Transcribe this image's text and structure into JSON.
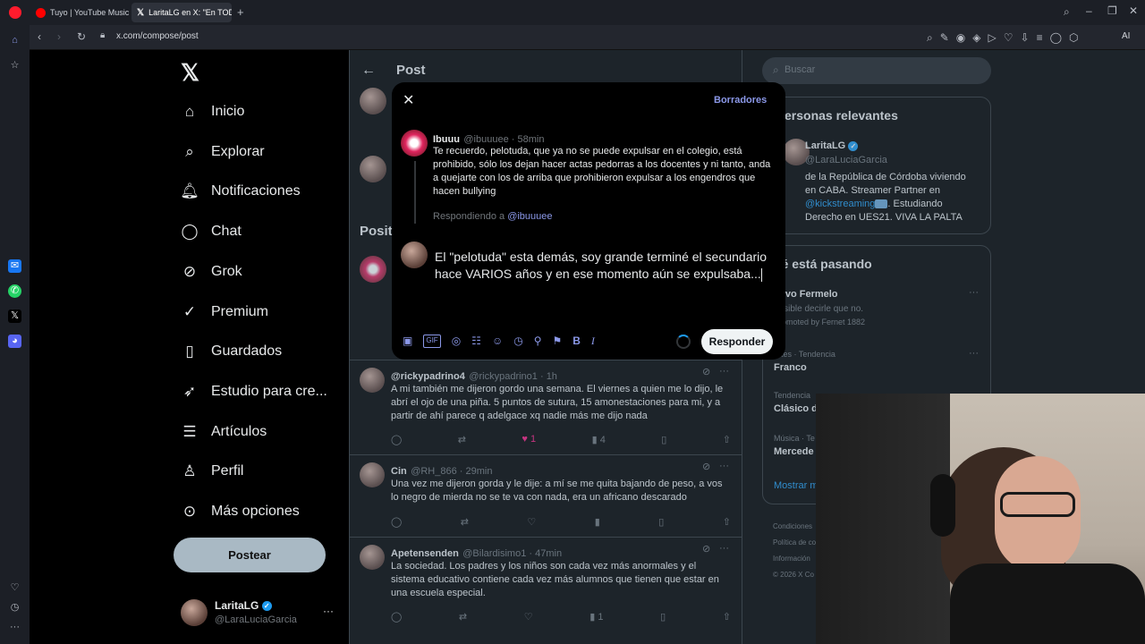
{
  "browser": {
    "tabs": [
      {
        "label": "Tuyo | YouTube Music"
      },
      {
        "label": "LaritaLG en X: \"En TODAS"
      }
    ],
    "url": "x.com/compose/post",
    "ai_label": "AI"
  },
  "nav": {
    "items": [
      {
        "label": "Inicio",
        "icon": "home-icon"
      },
      {
        "label": "Explorar",
        "icon": "search-icon"
      },
      {
        "label": "Notificaciones",
        "icon": "bell-icon"
      },
      {
        "label": "Chat",
        "icon": "chat-icon"
      },
      {
        "label": "Grok",
        "icon": "grok-icon"
      },
      {
        "label": "Premium",
        "icon": "verified-icon"
      },
      {
        "label": "Guardados",
        "icon": "bookmark-icon"
      },
      {
        "label": "Estudio para cre...",
        "icon": "rocket-icon"
      },
      {
        "label": "Artículos",
        "icon": "article-icon"
      },
      {
        "label": "Perfil",
        "icon": "person-icon"
      },
      {
        "label": "Más opciones",
        "icon": "more-circle-icon"
      }
    ],
    "post_button": "Postear",
    "account": {
      "name": "LaritaLG",
      "handle": "@LaraLuciaGarcia",
      "more": "···"
    }
  },
  "center": {
    "header": "Post",
    "section_label": "Posit",
    "tweets": [
      {
        "name": "@rickypadrino4",
        "handle": "@rickypadrino1 · 1h",
        "text": "A mi también me dijeron gordo una semana. El viernes a quien me lo dijo, le abrí el ojo de una piña. 5 puntos de sutura, 15 amonestaciones para mi, y a partir de ahí parece q adelgace xq nadie más me dijo nada",
        "likes": "1",
        "views": "4",
        "more": "···"
      },
      {
        "name": "Cin",
        "handle": "@RH_866 · 29min",
        "text": "Una vez me dijeron gorda y le dije: a mí se me quita bajando de peso, a vos lo negro de mierda no se te va con nada, era un africano descarado",
        "likes": "",
        "views": "",
        "more": "···"
      },
      {
        "name": "Apetensenden",
        "handle": "@Bilardisimo1 · 47min",
        "text": "La sociedad. Los padres y los niños son cada vez más anormales y el sistema educativo contiene cada vez más alumnos que tienen que estar en una escuela especial.",
        "likes": "",
        "views": "1",
        "more": "···"
      }
    ]
  },
  "modal": {
    "drafts": "Borradores",
    "original": {
      "name": "Ibuuu",
      "handle": "@ibuuuee · 58min",
      "text": "Te recuerdo, pelotuda, que ya no se puede expulsar en el colegio, está prohibido, sólo los dejan hacer actas pedorras a los docentes y ni tanto, anda a quejarte con los de arriba que prohibieron expulsar a los engendros que hacen bullying"
    },
    "replying_prefix": "Respondiendo a ",
    "replying_handle": "@ibuuuee",
    "reply_text": "El \"pelotuda\" esta demás, soy grande terminé el secundario hace VARIOS años y en ese momento aún se expulsaba...",
    "reply_button": "Responder",
    "toolbar_icons": [
      "image-icon",
      "gif-icon",
      "grok-icon",
      "poll-icon",
      "emoji-icon",
      "schedule-icon",
      "location-icon",
      "flag-icon",
      "bold-icon",
      "italic-icon"
    ]
  },
  "right": {
    "search_placeholder": "Buscar",
    "relevant_title": "ersonas relevantes",
    "person": {
      "name": "LaritaLG",
      "handle": "@LaraLuciaGarcia",
      "bio1": "de la República de Córdoba viviendo",
      "bio2": "en CABA. Streamer Partner en",
      "bio3_link": "@kickstreaming",
      "bio3_rest": ". Estudiando",
      "bio4": "Derecho en UES21. VIVA LA PALTA"
    },
    "trends_title": "ué está pasando",
    "trends": [
      {
        "meta": "",
        "title": "uevo Fermelo",
        "sub": "posible decirle que no.",
        "sub2": "Promoted by Fernet 1882"
      },
      {
        "meta": "ortes · Tendencia",
        "title": "Franco"
      },
      {
        "meta": "Tendencia",
        "title": "Clásico d"
      },
      {
        "meta": "Música · Te",
        "title": "Mercede"
      }
    ],
    "show_more": "Mostrar m",
    "footer": [
      "Condiciones",
      "Política de co",
      "Información",
      "© 2026 X Co"
    ]
  },
  "colors": {
    "accent": "#1d9bf0",
    "link": "#8b98e8",
    "like": "#f91880",
    "post_button": "#a9b9c4"
  }
}
